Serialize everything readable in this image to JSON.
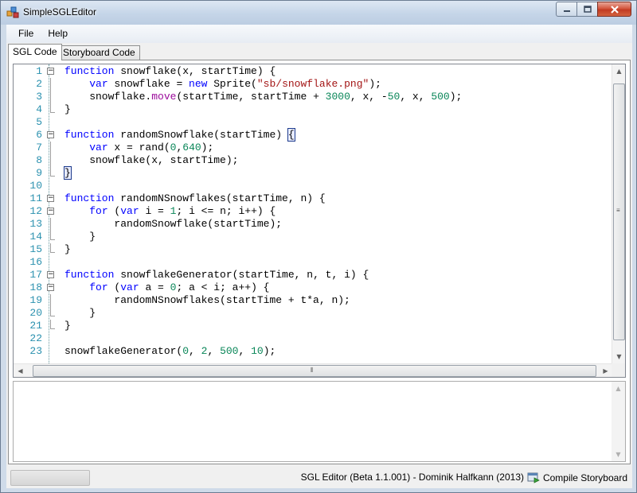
{
  "window": {
    "title": "SimpleSGLEditor",
    "icon": "app-icon",
    "buttons": [
      "minimize-icon",
      "maximize-icon",
      "close-icon"
    ]
  },
  "menu": {
    "items": [
      {
        "label": "File"
      },
      {
        "label": "Help"
      }
    ]
  },
  "tabs": [
    {
      "label": "SGL Code",
      "active": true
    },
    {
      "label": "Storyboard Code",
      "active": false
    }
  ],
  "editor": {
    "lines": [
      {
        "n": "1"
      },
      {
        "n": "2"
      },
      {
        "n": "3"
      },
      {
        "n": "4"
      },
      {
        "n": "5"
      },
      {
        "n": "6"
      },
      {
        "n": "7"
      },
      {
        "n": "8"
      },
      {
        "n": "9"
      },
      {
        "n": "10"
      },
      {
        "n": "11"
      },
      {
        "n": "12"
      },
      {
        "n": "13"
      },
      {
        "n": "14"
      },
      {
        "n": "15"
      },
      {
        "n": "16"
      },
      {
        "n": "17"
      },
      {
        "n": "18"
      },
      {
        "n": "19"
      },
      {
        "n": "20"
      },
      {
        "n": "21"
      },
      {
        "n": "22"
      },
      {
        "n": "23"
      }
    ],
    "code": [
      [
        "function",
        " snowflake(x, startTime) {"
      ],
      [
        "    ",
        "var",
        " snowflake = ",
        "new",
        " Sprite(",
        "\"sb/snowflake.png\"",
        ");"
      ],
      [
        "    snowflake.",
        "move",
        "(startTime, startTime + ",
        "3000",
        ", x, -",
        "50",
        ", x, ",
        "500",
        ");"
      ],
      [
        "}"
      ],
      [
        ""
      ],
      [
        "function",
        " randomSnowflake(startTime) ",
        "{"
      ],
      [
        "    ",
        "var",
        " x = rand(",
        "0",
        ",",
        "640",
        ");"
      ],
      [
        "    snowflake(x, startTime);"
      ],
      [
        "}"
      ],
      [
        ""
      ],
      [
        "function",
        " randomNSnowflakes(startTime, n) {"
      ],
      [
        "    ",
        "for",
        " (",
        "var",
        " i = ",
        "1",
        "; i <= n; i++) {"
      ],
      [
        "        randomSnowflake(startTime);"
      ],
      [
        "    }"
      ],
      [
        "}"
      ],
      [
        ""
      ],
      [
        "function",
        " snowflakeGenerator(startTime, n, t, i) {"
      ],
      [
        "    ",
        "for",
        " (",
        "var",
        " a = ",
        "0",
        "; a < i; a++) {"
      ],
      [
        "        randomNSnowflakes(startTime + t*a, n);"
      ],
      [
        "    }"
      ],
      [
        "}"
      ],
      [
        ""
      ],
      [
        "snowflakeGenerator(",
        "0",
        ", ",
        "2",
        ", ",
        "500",
        ", ",
        "10",
        ");"
      ]
    ]
  },
  "status": {
    "text": "SGL Editor (Beta 1.1.001) - Dominik Halfkann (2013)",
    "compile_label": "Compile Storyboard"
  },
  "colors": {
    "keyword": "#0000ff",
    "string": "#a31515",
    "number": "#098658",
    "method": "#9b0a9b",
    "line_number": "#2b91af"
  }
}
